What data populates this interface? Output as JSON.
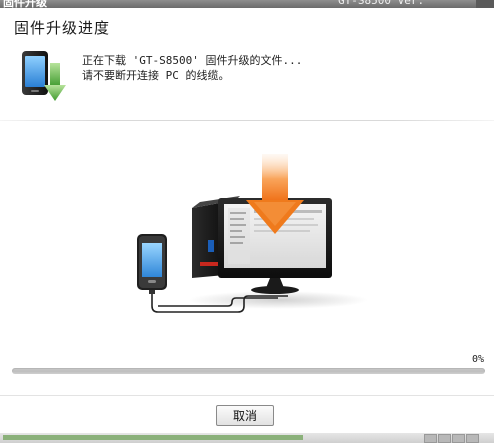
{
  "window": {
    "app_title": "固件升级",
    "version": "GT-S8500 Ver. 11.12.20.01"
  },
  "header": {
    "title": "固件升级进度",
    "icon": "phone-download-icon",
    "message_line1": "正在下载 'GT-S8500' 固件升级的文件...",
    "message_line2": "请不要断开连接 PC 的线缆。"
  },
  "illustration": {
    "name": "phone-connected-to-pc-illustration",
    "icons": [
      "smartphone-icon",
      "usb-cable-icon",
      "computer-tower-icon",
      "monitor-icon",
      "download-arrow-icon"
    ]
  },
  "progress": {
    "label": "0%",
    "value": 0,
    "color": "#3b8fe0"
  },
  "footer": {
    "cancel_label": "取消"
  },
  "colors": {
    "accent_orange": "#f07a1a",
    "phone_screen": "#4aa3e6",
    "arrow_green": "#5fb94a"
  }
}
